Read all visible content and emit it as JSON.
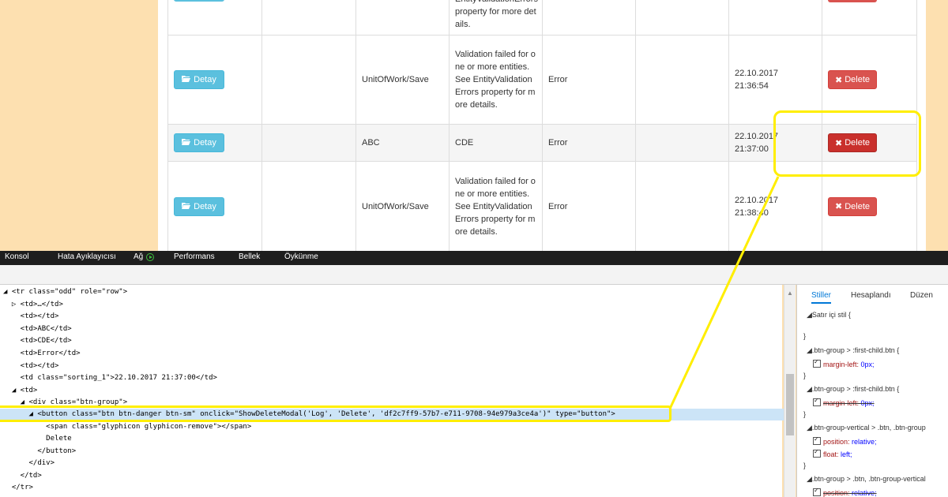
{
  "table": {
    "rows": [
      {
        "col2": "",
        "col3": "",
        "col4": "EntityValidationErrors property for more details.",
        "col5": "",
        "col6": "",
        "col7": "",
        "delete": "Delete",
        "partial": true
      },
      {
        "detay": "Detay",
        "col2": "",
        "col3": "UnitOfWork/Save",
        "col4": "Validation failed for one or more entities. See EntityValidationErrors property for more details.",
        "col5": "Error",
        "col6": "",
        "col7": "22.10.2017 21:36:54",
        "delete": "Delete"
      },
      {
        "detay": "Detay",
        "col2": "",
        "col3": "ABC",
        "col4": "CDE",
        "col5": "Error",
        "col6": "",
        "col7": "22.10.2017 21:37:00",
        "delete": "Delete"
      },
      {
        "detay": "Detay",
        "col2": "",
        "col3": "UnitOfWork/Save",
        "col4": "Validation failed for one or more entities. See EntityValidationErrors property for more details.",
        "col5": "Error",
        "col6": "",
        "col7": "22.10.2017 21:38:40",
        "delete": "Delete"
      }
    ]
  },
  "devtools": {
    "tabs": [
      "Konsol",
      "Hata Ayıklayıcısı",
      "Ağ",
      "Performans",
      "Bellek",
      "Öykünme"
    ],
    "dom_lines": [
      "◢ <tr class=\"odd\" role=\"row\">",
      "  ▷ <td>…</td>",
      "    <td></td>",
      "    <td>ABC</td>",
      "    <td>CDE</td>",
      "    <td>Error</td>",
      "    <td></td>",
      "    <td class=\"sorting_1\">22.10.2017 21:37:00</td>",
      "  ◢ <td>",
      "    ◢ <div class=\"btn-group\">",
      "      ◢ <button class=\"btn btn-danger btn-sm\" onclick=\"ShowDeleteModal('Log', 'Delete', 'df2c7ff9-57b7-e711-9708-94e979a3ce4a')\" type=\"button\">",
      "          <span class=\"glyphicon glyphicon-remove\"></span>",
      "          Delete",
      "        </button>",
      "      </div>",
      "    </td>",
      "  </tr>"
    ],
    "styles_tabs": [
      "Stiller",
      "Hesaplandı",
      "Düzen"
    ],
    "styles": {
      "inline": "Satır içi stil  {",
      "close": "}",
      "rules": [
        {
          "selector": ".btn-group > :first-child.btn  {",
          "prop": "margin-left:",
          "val": "0px;",
          "struck": false
        },
        {
          "selector": ".btn-group > :first-child.btn  {",
          "prop": "margin-left:",
          "val": "0px;",
          "struck": true
        },
        {
          "selector": ".btn-group-vertical > .btn, .btn-group",
          "prop": "position:",
          "val": "relative;",
          "prop2": "float:",
          "val2": "left;"
        },
        {
          "selector": ".btn-group > .btn, .btn-group-vertical",
          "prop": "position:",
          "val": "relative;",
          "struck": true
        }
      ]
    }
  },
  "colors": {
    "highlight": "#ffee00",
    "danger": "#d9534f",
    "info": "#5bc0de"
  }
}
